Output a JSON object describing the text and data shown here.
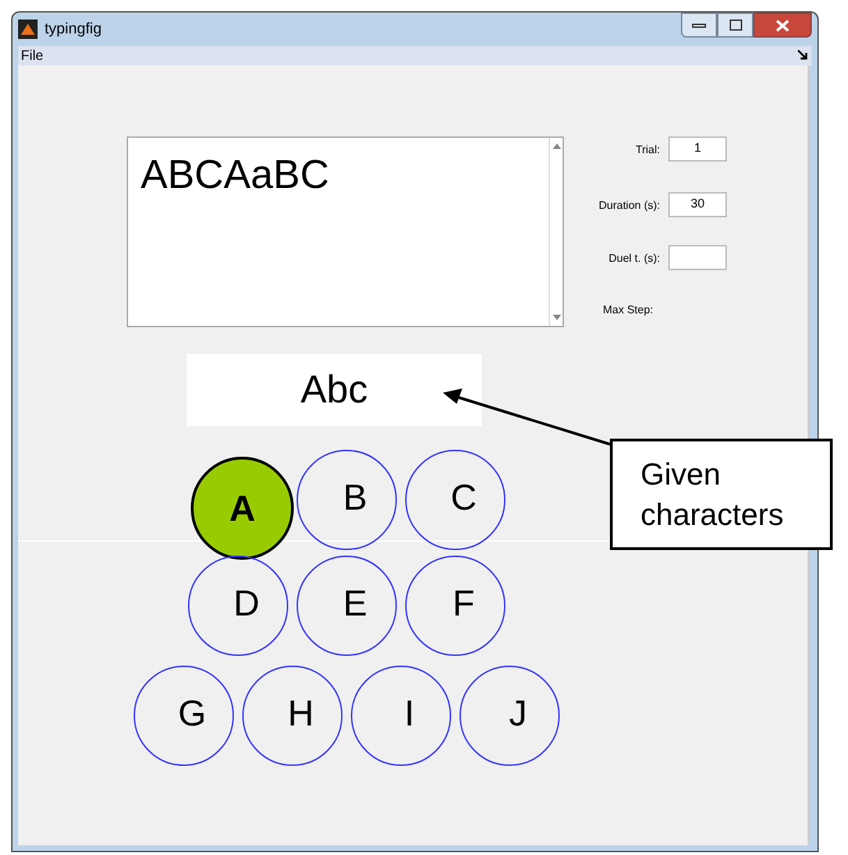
{
  "window": {
    "title": "typingfig"
  },
  "menu": [
    "File"
  ],
  "typed_text": "ABCAaBC",
  "fields": [
    {
      "label": "Trial:",
      "value": "1"
    },
    {
      "label": "Duration (s):",
      "value": "30"
    },
    {
      "label": "Duel t. (s):"
    }
  ],
  "max_step": {
    "label": "Max Step:"
  },
  "given_text": "Abc",
  "keys": [
    [
      {
        "letter": "A",
        "selected": true
      },
      {
        "letter": "B",
        "selected": false
      },
      {
        "letter": "C",
        "selected": false
      }
    ],
    [
      {
        "letter": "D",
        "selected": false
      },
      {
        "letter": "E",
        "selected": false
      },
      {
        "letter": "F",
        "selected": false
      }
    ],
    [
      {
        "letter": "G",
        "selected": false
      },
      {
        "letter": "H",
        "selected": false
      },
      {
        "letter": "I",
        "selected": false
      },
      {
        "letter": "J",
        "selected": false
      }
    ]
  ],
  "callout": "Given characters"
}
